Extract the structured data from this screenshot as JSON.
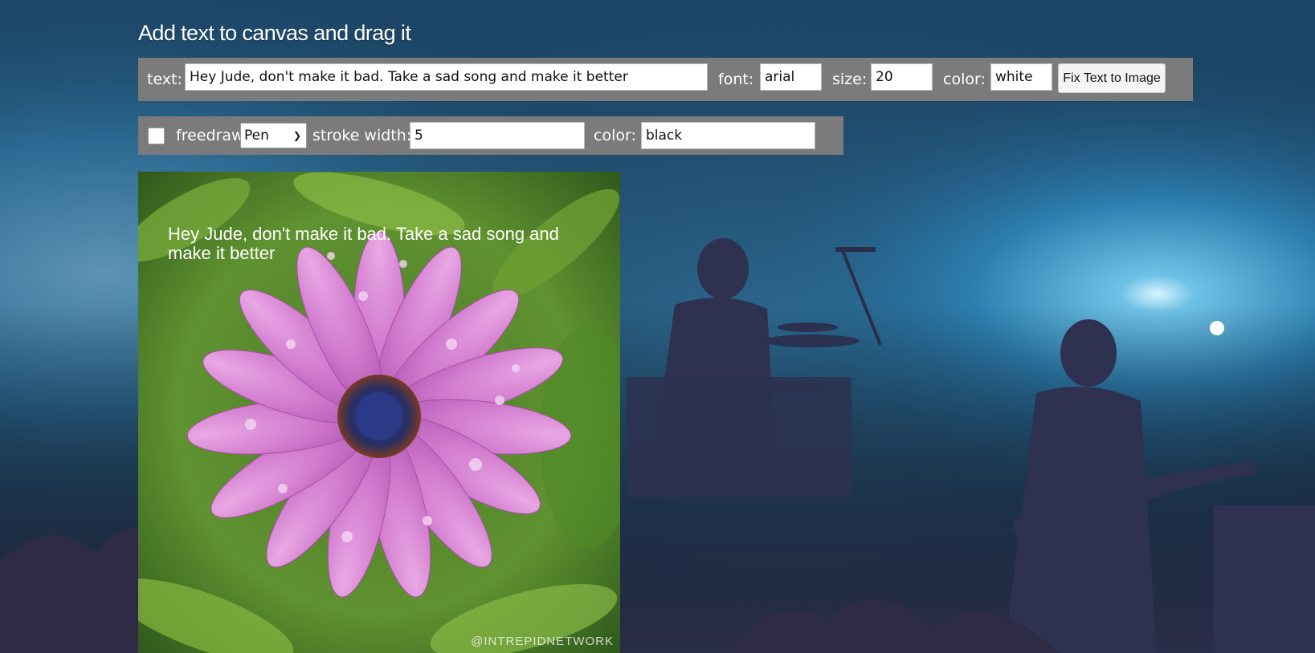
{
  "page": {
    "title": "Add text to canvas and drag it"
  },
  "text_toolbar": {
    "text_label": "text:",
    "text_value": "Hey Jude, don't make it bad. Take a sad song and make it better",
    "font_label": "font:",
    "font_value": "arial",
    "size_label": "size:",
    "size_value": "20",
    "color_label": "color:",
    "color_value": "white",
    "fix_button_label": "Fix Text to Image"
  },
  "draw_toolbar": {
    "freedraw_checked": false,
    "freedraw_label": "freedraw",
    "tool_selected": "Pen",
    "stroke_width_label": "stroke width:",
    "stroke_width_value": "5",
    "color_label": "color:",
    "color_value": "black"
  },
  "canvas": {
    "overlay_text": "Hey Jude, don't make it bad. Take a sad song and make it better",
    "watermark": "@INTREPIDNETWORK"
  },
  "colors": {
    "toolbar_bg": "#7b7b7b",
    "canvas_text": "#ffffff",
    "background_tone": "#1f3d55"
  }
}
